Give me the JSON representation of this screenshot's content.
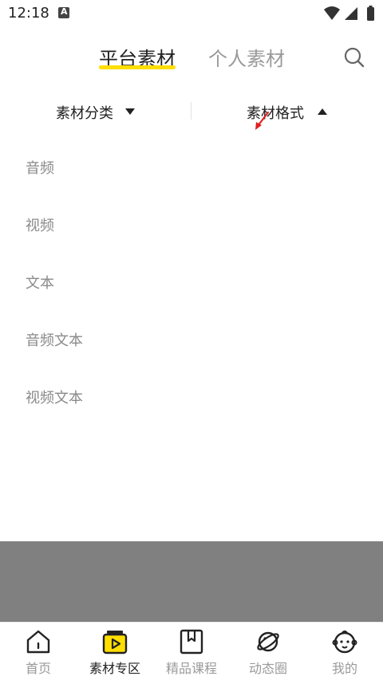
{
  "status_bar": {
    "time": "12:18",
    "notification_icon": "a-notification-icon",
    "icons": [
      "wifi-icon",
      "signal-icon",
      "battery-icon"
    ]
  },
  "top_tabs": {
    "active_tab": "平台素材",
    "other_tab": "个人素材",
    "indicator_color": "#ffde00"
  },
  "filters": {
    "category_label": "素材分类",
    "format_label": "素材格式"
  },
  "format_options": [
    "音频",
    "视频",
    "文本",
    "音频文本",
    "视频文本"
  ],
  "bottom_nav": [
    {
      "label": "首页",
      "icon": "home-icon",
      "active": false
    },
    {
      "label": "素材专区",
      "icon": "material-zone-icon",
      "active": true
    },
    {
      "label": "精品课程",
      "icon": "bookmark-course-icon",
      "active": false
    },
    {
      "label": "动态圈",
      "icon": "planet-icon",
      "active": false
    },
    {
      "label": "我的",
      "icon": "baby-face-icon",
      "active": false
    }
  ],
  "colors": {
    "accent": "#ffde00",
    "overlay": "#808080",
    "muted_text": "#8a8a8a"
  }
}
